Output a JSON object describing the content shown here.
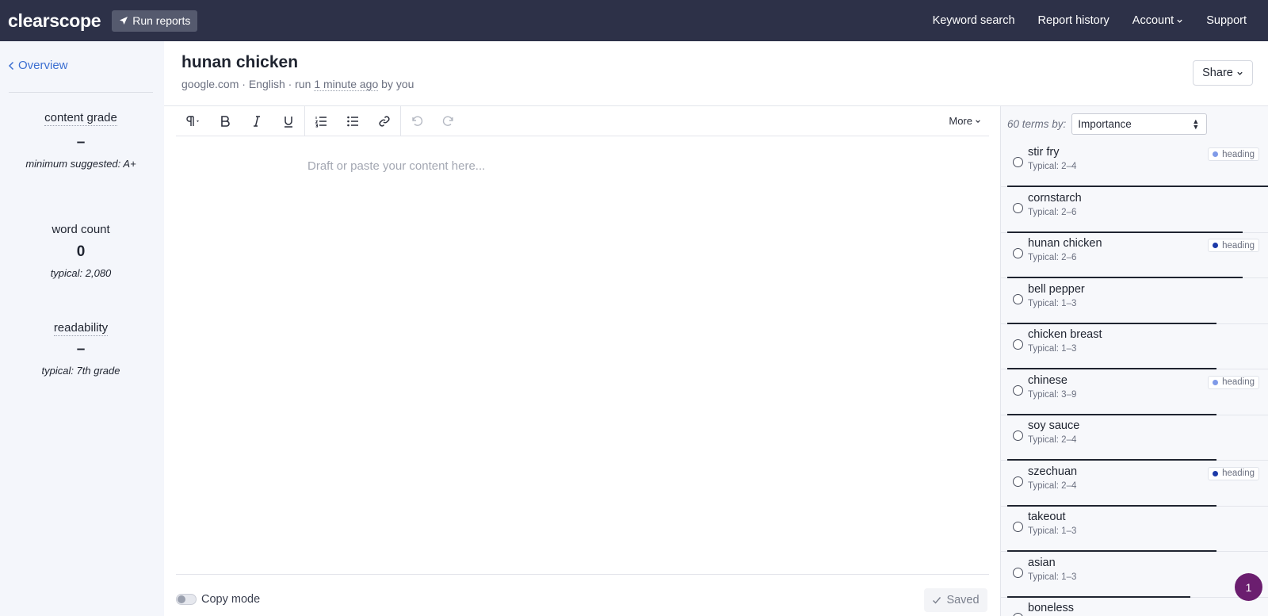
{
  "nav": {
    "logo": "clearscope",
    "run_reports": "Run reports",
    "links": [
      "Keyword search",
      "Report history",
      "Account",
      "Support"
    ]
  },
  "sidebar": {
    "back_label": "Overview",
    "content_grade": {
      "label": "content grade",
      "value": "–",
      "sub": "minimum suggested: A+"
    },
    "word_count": {
      "label": "word count",
      "value": "0",
      "sub": "typical: 2,080"
    },
    "readability": {
      "label": "readability",
      "value": "–",
      "sub": "typical: 7th grade"
    }
  },
  "report": {
    "title": "hunan chicken",
    "meta_prefix": "google.com · English · run ",
    "meta_time": "1 minute ago",
    "meta_suffix": " by you",
    "share_label": "Share"
  },
  "editor": {
    "placeholder": "Draft or paste your content here...",
    "more_label": "More",
    "copy_mode_label": "Copy mode",
    "saved_label": "Saved"
  },
  "terms": {
    "count_label": "60 terms by:",
    "sort_value": "Importance",
    "heading_label": "heading",
    "colors": {
      "heading_light": "#7f9ae8",
      "heading_dark": "#1d3aa8"
    },
    "items": [
      {
        "name": "stir fry",
        "typical": "Typical: 2–4",
        "heading": "light",
        "importance": 1.0
      },
      {
        "name": "cornstarch",
        "typical": "Typical: 2–6",
        "heading": null,
        "importance": 0.9
      },
      {
        "name": "hunan chicken",
        "typical": "Typical: 2–6",
        "heading": "dark",
        "importance": 0.9
      },
      {
        "name": "bell pepper",
        "typical": "Typical: 1–3",
        "heading": null,
        "importance": 0.8
      },
      {
        "name": "chicken breast",
        "typical": "Typical: 1–3",
        "heading": null,
        "importance": 0.8
      },
      {
        "name": "chinese",
        "typical": "Typical: 3–9",
        "heading": "light",
        "importance": 0.8
      },
      {
        "name": "soy sauce",
        "typical": "Typical: 2–4",
        "heading": null,
        "importance": 0.8
      },
      {
        "name": "szechuan",
        "typical": "Typical: 2–4",
        "heading": "dark",
        "importance": 0.8
      },
      {
        "name": "takeout",
        "typical": "Typical: 1–3",
        "heading": null,
        "importance": 0.8
      },
      {
        "name": "asian",
        "typical": "Typical: 1–3",
        "heading": null,
        "importance": 0.7
      },
      {
        "name": "boneless",
        "typical": "",
        "heading": null,
        "importance": 0.7
      }
    ]
  },
  "notification_count": "1"
}
